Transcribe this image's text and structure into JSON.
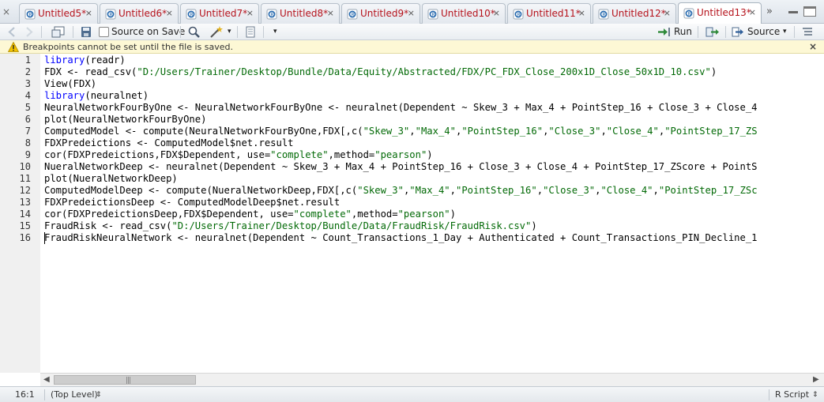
{
  "tabs": [
    {
      "label": "Untitled5*",
      "active": false
    },
    {
      "label": "Untitled6*",
      "active": false
    },
    {
      "label": "Untitled7*",
      "active": false
    },
    {
      "label": "Untitled8*",
      "active": false
    },
    {
      "label": "Untitled9*",
      "active": false
    },
    {
      "label": "Untitled10*",
      "active": false
    },
    {
      "label": "Untitled11*",
      "active": false
    },
    {
      "label": "Untitled12*",
      "active": false
    },
    {
      "label": "Untitled13*",
      "active": true
    }
  ],
  "tab_close_glyph": "×",
  "tab_overflow_glyph": "»",
  "toolbar": {
    "source_on_save_label": "Source on Save",
    "source_on_save_checked": false,
    "run_label": "Run",
    "source_label": "Source"
  },
  "warning": {
    "text": "Breakpoints cannot be set until the file is saved.",
    "close_glyph": "×"
  },
  "editor": {
    "lines": [
      [
        {
          "t": "library",
          "c": "kw"
        },
        {
          "t": "(readr)",
          "c": ""
        }
      ],
      [
        {
          "t": "FDX <- read_csv(",
          "c": ""
        },
        {
          "t": "\"D:/Users/Trainer/Desktop/Bundle/Data/Equity/Abstracted/FDX/PC_FDX_Close_200x1D_Close_50x1D_10.csv\"",
          "c": "str"
        },
        {
          "t": ")",
          "c": ""
        }
      ],
      [
        {
          "t": "View(FDX)",
          "c": ""
        }
      ],
      [
        {
          "t": "library",
          "c": "kw"
        },
        {
          "t": "(neuralnet)",
          "c": ""
        }
      ],
      [
        {
          "t": "NeuralNetworkFourByOne <- NeuralNetworkFourByOne <- neuralnet(Dependent ~ Skew_3 + Max_4 + PointStep_16 + Close_3 + Close_4",
          "c": ""
        }
      ],
      [
        {
          "t": "plot(NeuralNetworkFourByOne)",
          "c": ""
        }
      ],
      [
        {
          "t": "ComputedModel <- compute(NeuralNetworkFourByOne,FDX[,c(",
          "c": ""
        },
        {
          "t": "\"Skew_3\"",
          "c": "str"
        },
        {
          "t": ",",
          "c": ""
        },
        {
          "t": "\"Max_4\"",
          "c": "str"
        },
        {
          "t": ",",
          "c": ""
        },
        {
          "t": "\"PointStep_16\"",
          "c": "str"
        },
        {
          "t": ",",
          "c": ""
        },
        {
          "t": "\"Close_3\"",
          "c": "str"
        },
        {
          "t": ",",
          "c": ""
        },
        {
          "t": "\"Close_4\"",
          "c": "str"
        },
        {
          "t": ",",
          "c": ""
        },
        {
          "t": "\"PointStep_17_ZS",
          "c": "str"
        }
      ],
      [
        {
          "t": "FDXPredeictions <- ComputedModel$net.result",
          "c": ""
        }
      ],
      [
        {
          "t": "cor(FDXPredeictions,FDX$Dependent, use=",
          "c": ""
        },
        {
          "t": "\"complete\"",
          "c": "str"
        },
        {
          "t": ",method=",
          "c": ""
        },
        {
          "t": "\"pearson\"",
          "c": "str"
        },
        {
          "t": ")",
          "c": ""
        }
      ],
      [
        {
          "t": "NueralNetworkDeep <- neuralnet(Dependent ~ Skew_3 + Max_4 + PointStep_16 + Close_3 + Close_4 + PointStep_17_ZScore + PointS",
          "c": ""
        }
      ],
      [
        {
          "t": "plot(NueralNetworkDeep)",
          "c": ""
        }
      ],
      [
        {
          "t": "ComputedModelDeep <- compute(NueralNetworkDeep,FDX[,c(",
          "c": ""
        },
        {
          "t": "\"Skew_3\"",
          "c": "str"
        },
        {
          "t": ",",
          "c": ""
        },
        {
          "t": "\"Max_4\"",
          "c": "str"
        },
        {
          "t": ",",
          "c": ""
        },
        {
          "t": "\"PointStep_16\"",
          "c": "str"
        },
        {
          "t": ",",
          "c": ""
        },
        {
          "t": "\"Close_3\"",
          "c": "str"
        },
        {
          "t": ",",
          "c": ""
        },
        {
          "t": "\"Close_4\"",
          "c": "str"
        },
        {
          "t": ",",
          "c": ""
        },
        {
          "t": "\"PointStep_17_ZSc",
          "c": "str"
        }
      ],
      [
        {
          "t": "FDXPredeictionsDeep <- ComputedModelDeep$net.result",
          "c": ""
        }
      ],
      [
        {
          "t": "cor(FDXPredeictionsDeep,FDX$Dependent, use=",
          "c": ""
        },
        {
          "t": "\"complete\"",
          "c": "str"
        },
        {
          "t": ",method=",
          "c": ""
        },
        {
          "t": "\"pearson\"",
          "c": "str"
        },
        {
          "t": ")",
          "c": ""
        }
      ],
      [
        {
          "t": "FraudRisk <- read_csv(",
          "c": ""
        },
        {
          "t": "\"D:/Users/Trainer/Desktop/Bundle/Data/FraudRisk/FraudRisk.csv\"",
          "c": "str"
        },
        {
          "t": ")",
          "c": ""
        }
      ],
      [
        {
          "t": "FraudRiskNeuralNetwork <- neuralnet(Dependent ~ Count_Transactions_1_Day + Authenticated + Count_Transactions_PIN_Decline_1",
          "c": ""
        }
      ]
    ],
    "cursor_line": 16,
    "colors": {
      "keyword": "#0000ff",
      "string": "#036a07"
    }
  },
  "status": {
    "position": "16:1",
    "scope": "(Top Level)",
    "file_type": "R Script"
  },
  "colors": {
    "tab_label": "#b5121b",
    "warning_bg": "#fdf8d5"
  }
}
